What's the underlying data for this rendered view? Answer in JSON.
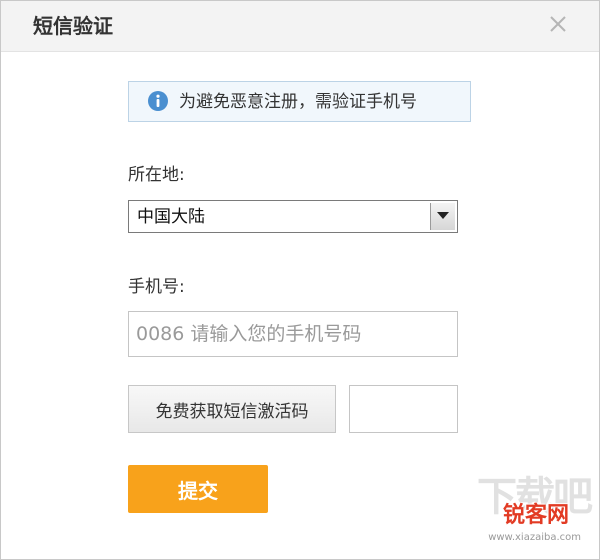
{
  "dialog": {
    "title": "短信验证",
    "close_icon": "close-icon"
  },
  "notice": {
    "icon": "info-icon",
    "text": "为避免恶意注册，需验证手机号",
    "accent": "#4a8fd0"
  },
  "location": {
    "label": "所在地:",
    "selected": "中国大陆",
    "arrow_icon": "dropdown-arrow-icon"
  },
  "phone": {
    "label": "手机号:",
    "value": "",
    "placeholder": "0086 请输入您的手机号码"
  },
  "sms": {
    "button_label": "免费获取短信激活码",
    "code_value": ""
  },
  "submit": {
    "label": "提交",
    "color": "#f8a21b"
  },
  "watermark": {
    "big_text": "下载吧",
    "brand": "锐客网",
    "url": "www.xiazaiba.com"
  }
}
